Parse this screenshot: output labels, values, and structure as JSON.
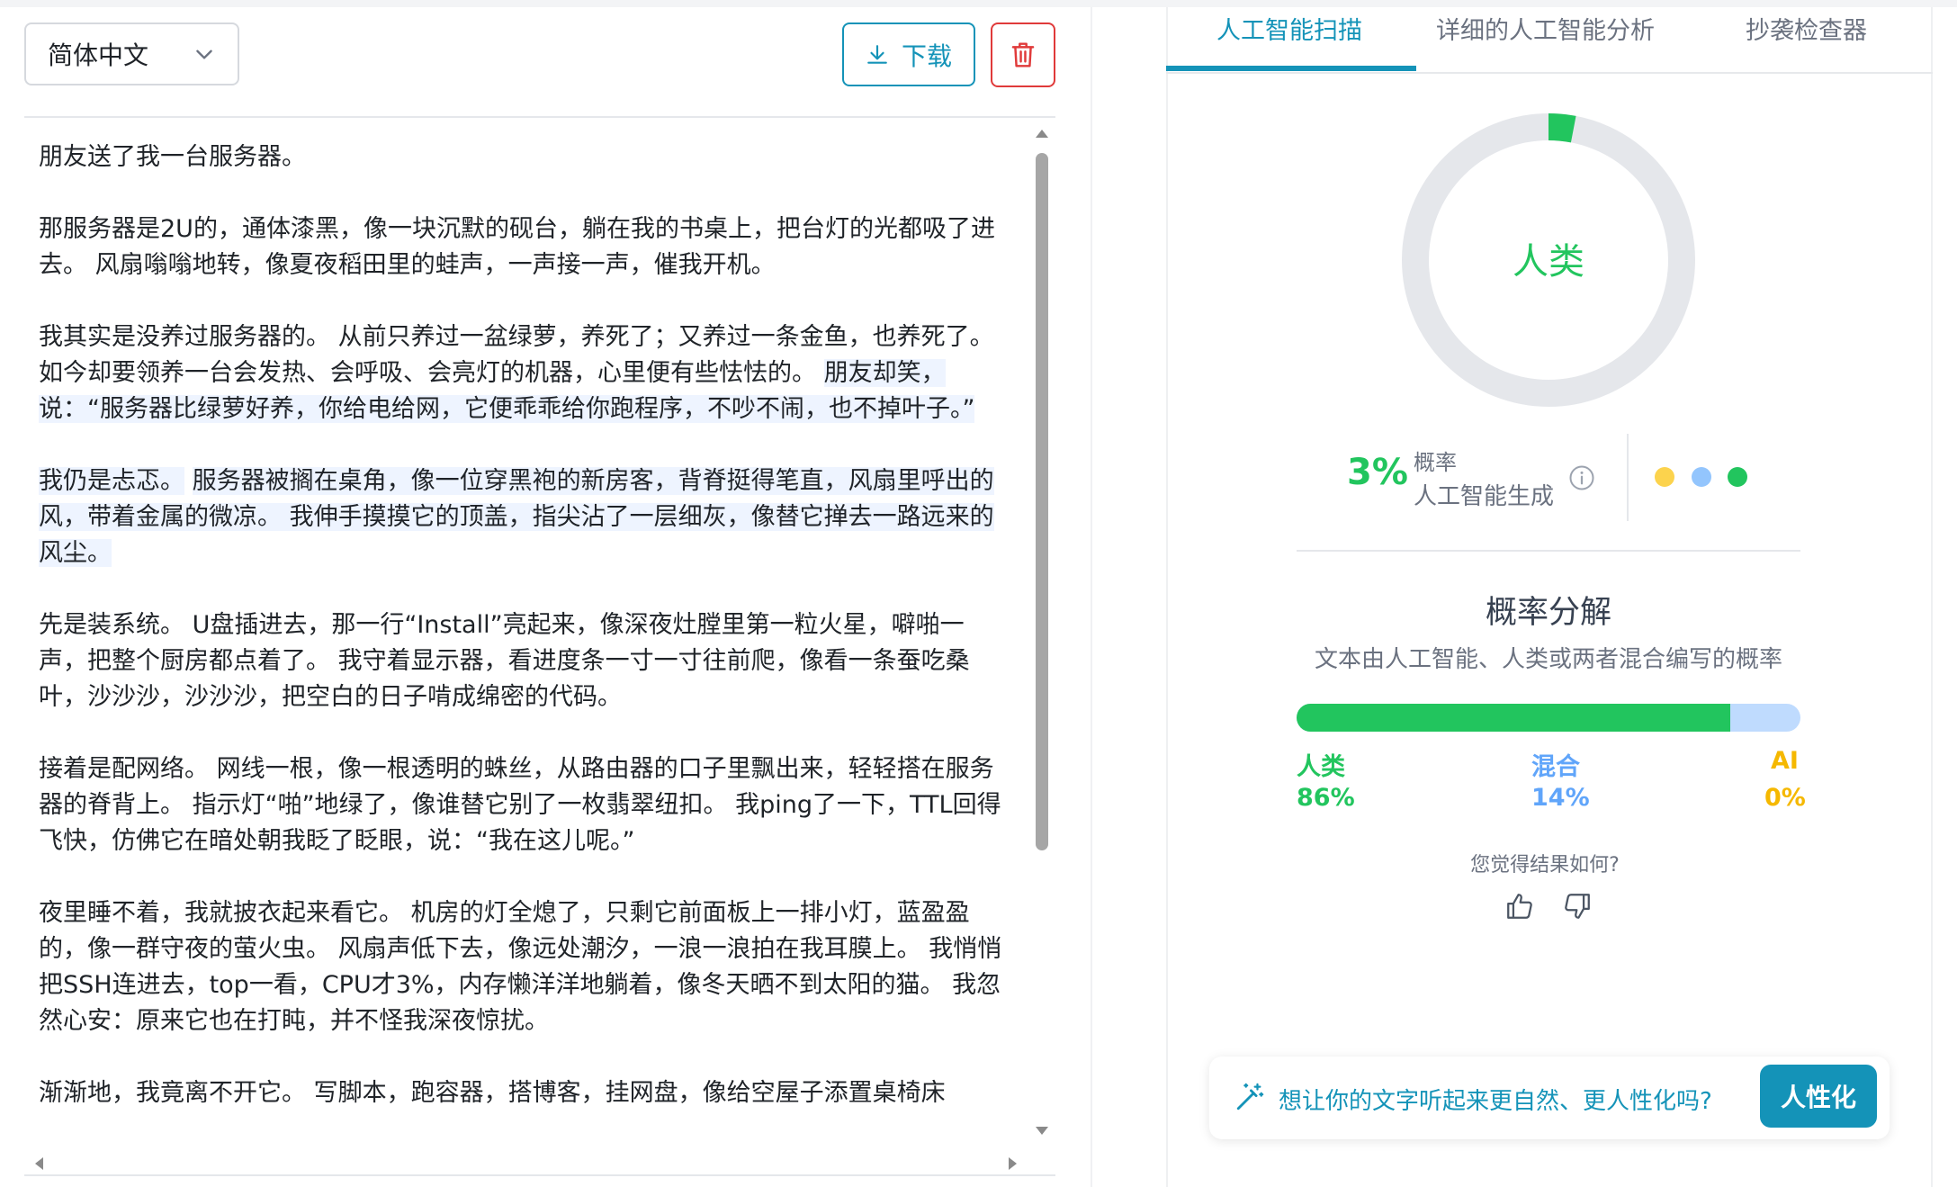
{
  "toolbar": {
    "language": "简体中文",
    "download_label": "下载"
  },
  "document": {
    "paragraphs": [
      "朋友送了我一台服务器。",
      "那服务器是2U的，通体漆黑，像一块沉默的砚台，躺在我的书桌上，把台灯的光都吸了进去。 风扇嗡嗡地转，像夏夜稻田里的蛙声，一声接一声，催我开机。",
      "我其实是没养过服务器的。 从前只养过一盆绿萝，养死了；又养过一条金鱼，也养死了。 如今却要领养一台会发热、会呼吸、会亮灯的机器，心里便有些怯怯的。",
      "朋友却笑，说：“服务器比绿萝好养，你给电给网，它便乖乖给你跑程序，不吵不闹，也不掉叶子。”",
      "我仍是忐忑。",
      "服务器被搁在桌角，像一位穿黑袍的新房客，背脊挺得笔直，风扇里呼出的风，带着金属的微凉。 我伸手摸摸它的顶盖，指尖沾了一层细灰，像替它掸去一路远来的风尘。",
      "先是装系统。 U盘插进去，那一行“Install”亮起来，像深夜灶膛里第一粒火星，噼啪一声，把整个厨房都点着了。 我守着显示器，看进度条一寸一寸往前爬，像看一条蚕吃桑叶，沙沙沙，沙沙沙，把空白的日子啃成绵密的代码。",
      "接着是配网络。 网线一根，像一根透明的蛛丝，从路由器的口子里飘出来，轻轻搭在服务器的脊背上。 指示灯“啪”地绿了，像谁替它别了一枚翡翠纽扣。 我ping了一下，TTL回得飞快，仿佛它在暗处朝我眨了眨眼，说：“我在这儿呢。”",
      "夜里睡不着，我就披衣起来看它。 机房的灯全熄了，只剩它前面板上一排小灯，蓝盈盈的，像一群守夜的萤火虫。 风扇声低下去，像远处潮汐，一浪一浪拍在我耳膜上。 我悄悄把SSH连进去，top一看，CPU才3%，内存懒洋洋地躺着，像冬天晒不到太阳的猫。 我忽然心安：原来它也在打盹，并不怪我深夜惊扰。",
      "渐渐地，我竟离不开它。 写脚本，跑容器，搭博客，挂网盘，像给空屋子添置桌椅床"
    ]
  },
  "tabs": [
    {
      "label": "人工智能扫描",
      "active": true
    },
    {
      "label": "详细的人工智能分析",
      "active": false
    },
    {
      "label": "抄袭检查器",
      "active": false
    }
  ],
  "result": {
    "verdict": "人类",
    "ai_percent_label": "3%",
    "ai_fraction": 0.03,
    "prob_title": "概率",
    "prob_sub": "人工智能生成",
    "indicator_colors": [
      "#fcd34d",
      "#93c5fd",
      "#22c55e"
    ]
  },
  "breakdown": {
    "title": "概率分解",
    "subtitle": "文本由人工智能、人类或两者混合编写的概率",
    "human_fraction": 0.86,
    "human_label": "人类",
    "human_value": "86%",
    "mixed_label": "混合",
    "mixed_value": "14%",
    "ai_label": "AI",
    "ai_value": "0%"
  },
  "feedback": {
    "question": "您觉得结果如何?"
  },
  "humanize": {
    "prompt": "想让你的文字听起来更自然、更人性化吗?",
    "button": "人性化"
  },
  "colors": {
    "accent": "#1493b8",
    "human": "#22c55e",
    "mixed": "#60a5fa",
    "ai": "#f5b800",
    "danger": "#e03a3a"
  }
}
